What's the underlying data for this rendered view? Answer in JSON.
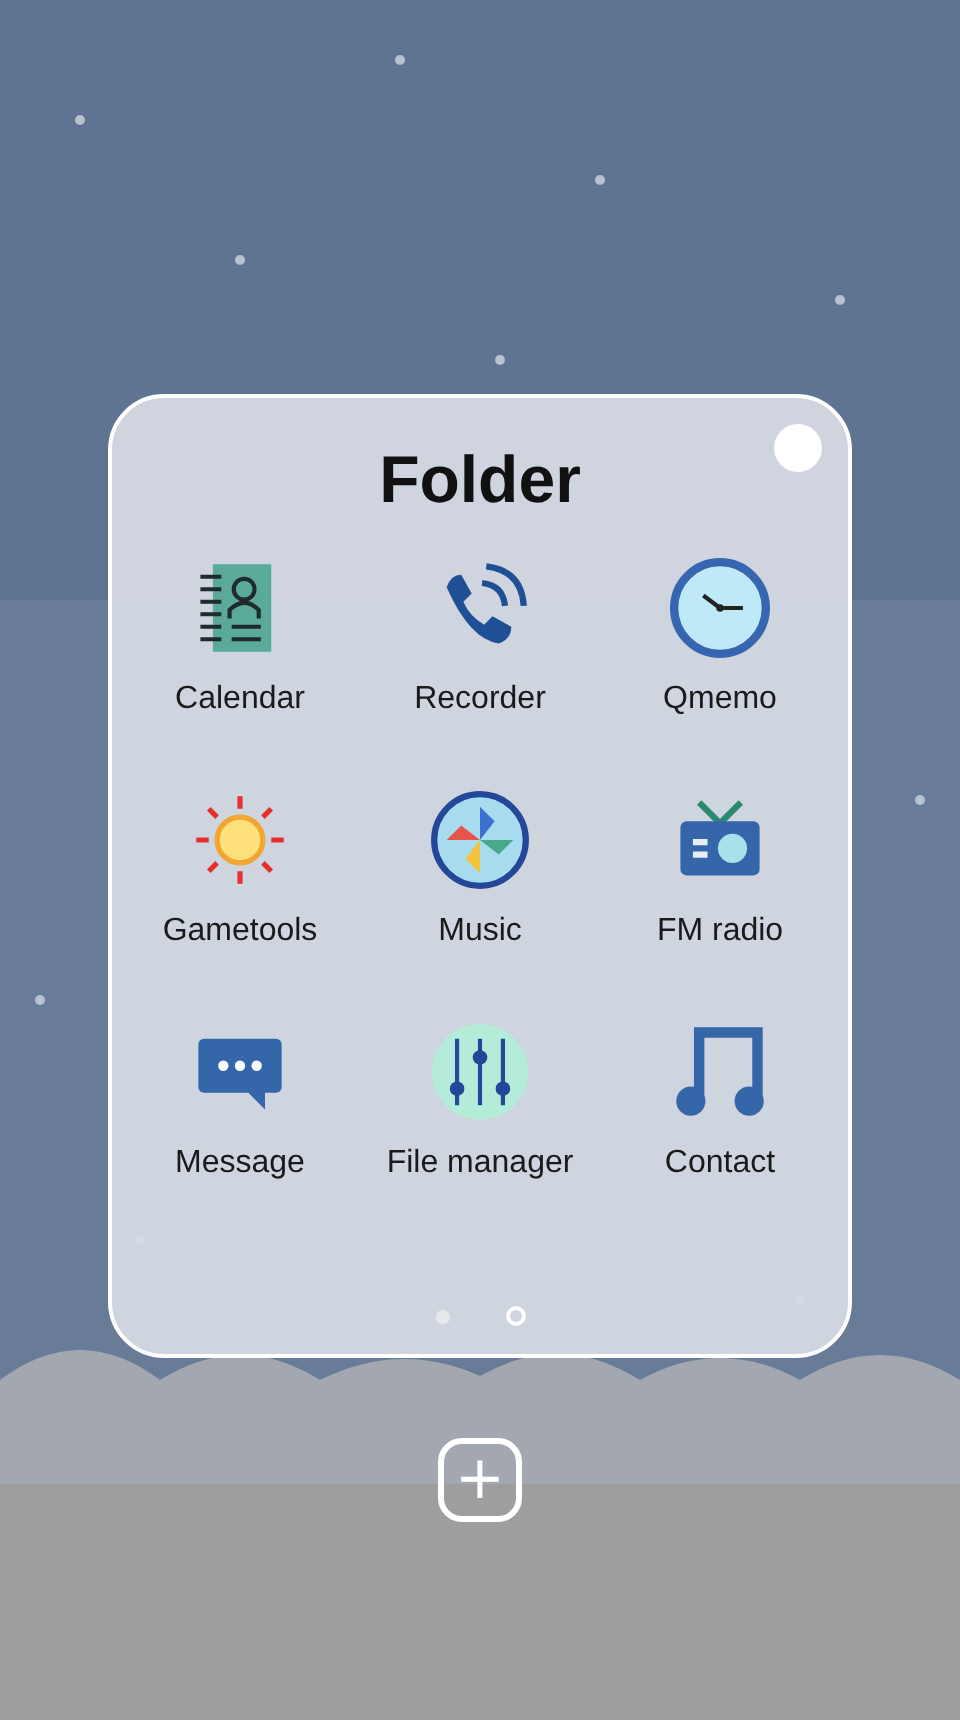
{
  "folder": {
    "title": "Folder",
    "apps": [
      {
        "label": "Calendar"
      },
      {
        "label": "Recorder"
      },
      {
        "label": "Qmemo"
      },
      {
        "label": "Gametools"
      },
      {
        "label": "Music"
      },
      {
        "label": "FM radio"
      },
      {
        "label": "Message"
      },
      {
        "label": "File manager"
      },
      {
        "label": "Contact"
      }
    ],
    "pages": [
      {
        "selected": false
      },
      {
        "selected": true
      }
    ]
  },
  "add_button": {
    "label": "+"
  }
}
